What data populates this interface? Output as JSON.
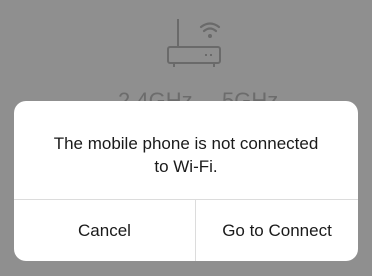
{
  "background": {
    "router_icon": "wifi-router-icon",
    "bands": [
      "2.4GHz",
      "5GHz"
    ],
    "overlay_color": "#8f8f8f"
  },
  "dialog": {
    "message": "The mobile phone is not connected\nto Wi-Fi.",
    "cancel_label": "Cancel",
    "connect_label": "Go to Connect"
  }
}
